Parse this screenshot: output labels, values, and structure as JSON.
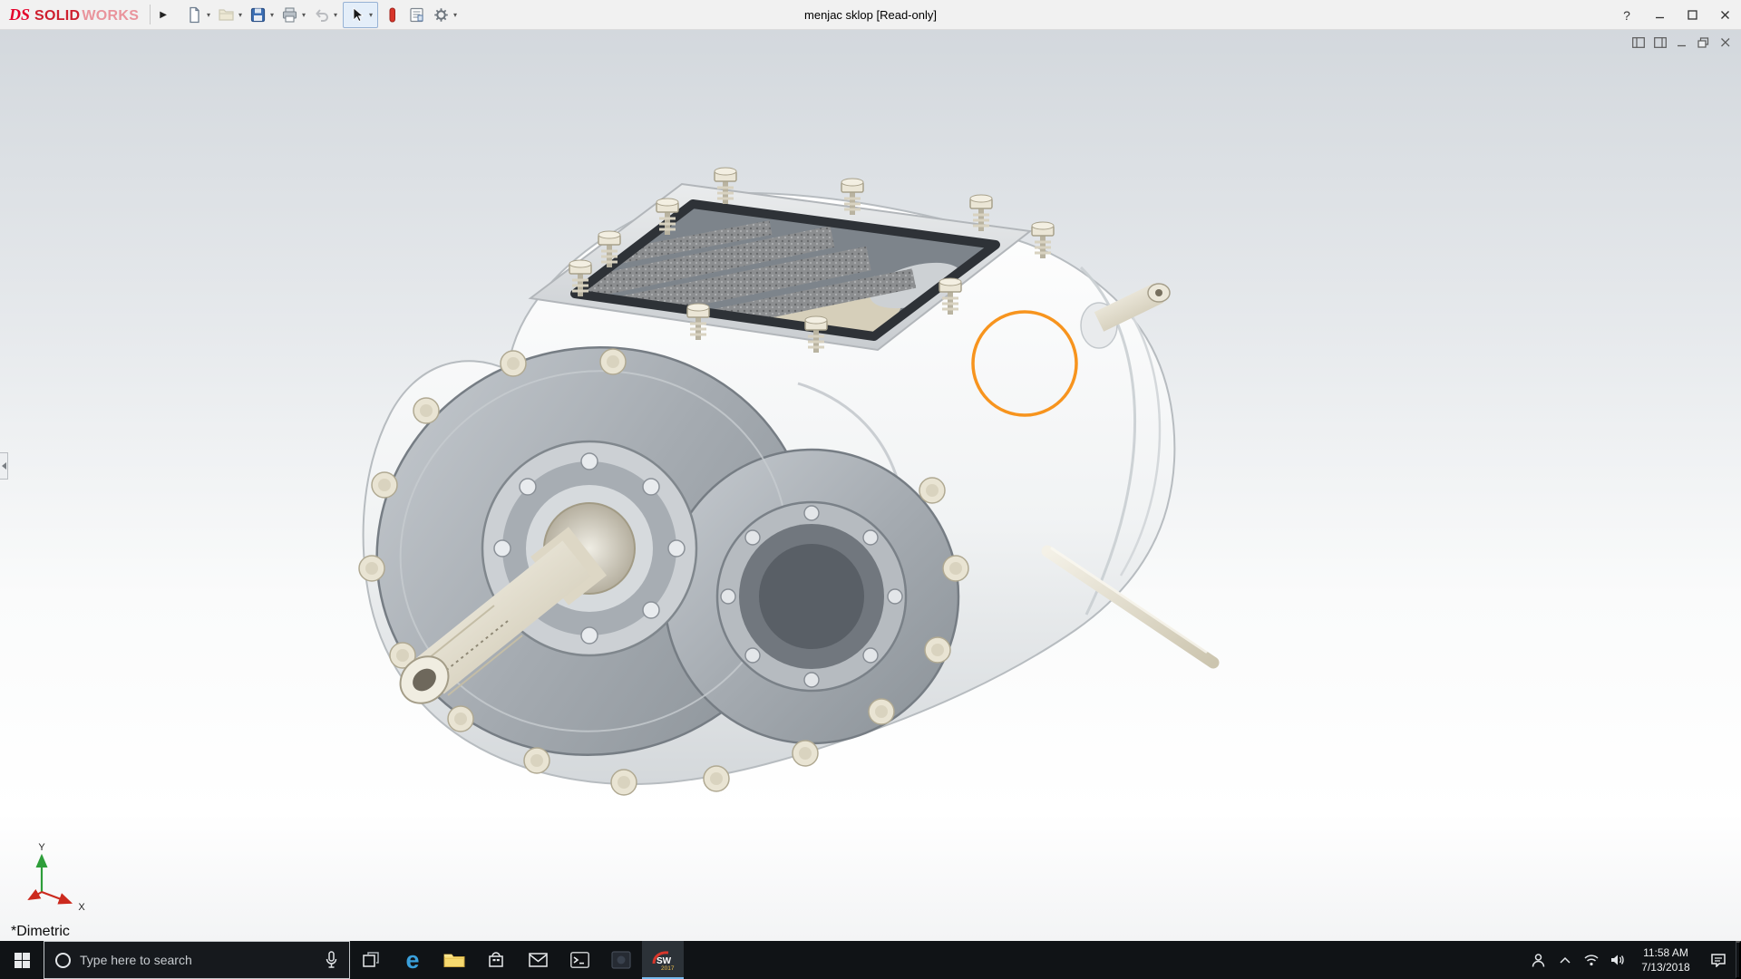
{
  "titlebar": {
    "brand": {
      "mark": "DS",
      "solid": "SOLID",
      "works": "WORKS"
    },
    "flyout_glyph": "▶",
    "caret_glyph": "▾",
    "document_title": "menjac sklop [Read-only]",
    "help_glyph": "?",
    "tool_icons": [
      "new-document-icon",
      "open-icon",
      "save-icon",
      "print-icon",
      "undo-icon",
      "select-cursor-icon",
      "appearance-icon",
      "report-icon",
      "gear-icon"
    ]
  },
  "viewport": {
    "orientation_label": "*Dimetric",
    "triad": {
      "x": "X",
      "y": "Y"
    },
    "annotation_circle_color": "#F7941E",
    "model": "gearbox assembly"
  },
  "taskbar": {
    "search_placeholder": "Type here to search",
    "time": "11:58 AM",
    "date": "7/13/2018",
    "edge_glyph": "e",
    "sw_glyph": "SW",
    "solidworks_badge": "2017",
    "app_icons": [
      "windows-start-icon",
      "cortana-circle-icon",
      "microphone-icon",
      "task-view-icon",
      "edge-icon",
      "file-explorer-icon",
      "store-icon",
      "mail-icon",
      "command-prompt-icon",
      "dark-app-tile-icon",
      "solidworks-icon"
    ],
    "tray_icons": [
      "people-icon",
      "chevron-up-icon",
      "wifi-icon",
      "volume-icon",
      "action-center-icon",
      "show-desktop-strip"
    ]
  },
  "colors": {
    "annotation_orange": "#F7941E",
    "brand_red": "#CE1F2E",
    "taskbar_bg": "#101316",
    "titlebar_bg": "#F1F1F1"
  }
}
